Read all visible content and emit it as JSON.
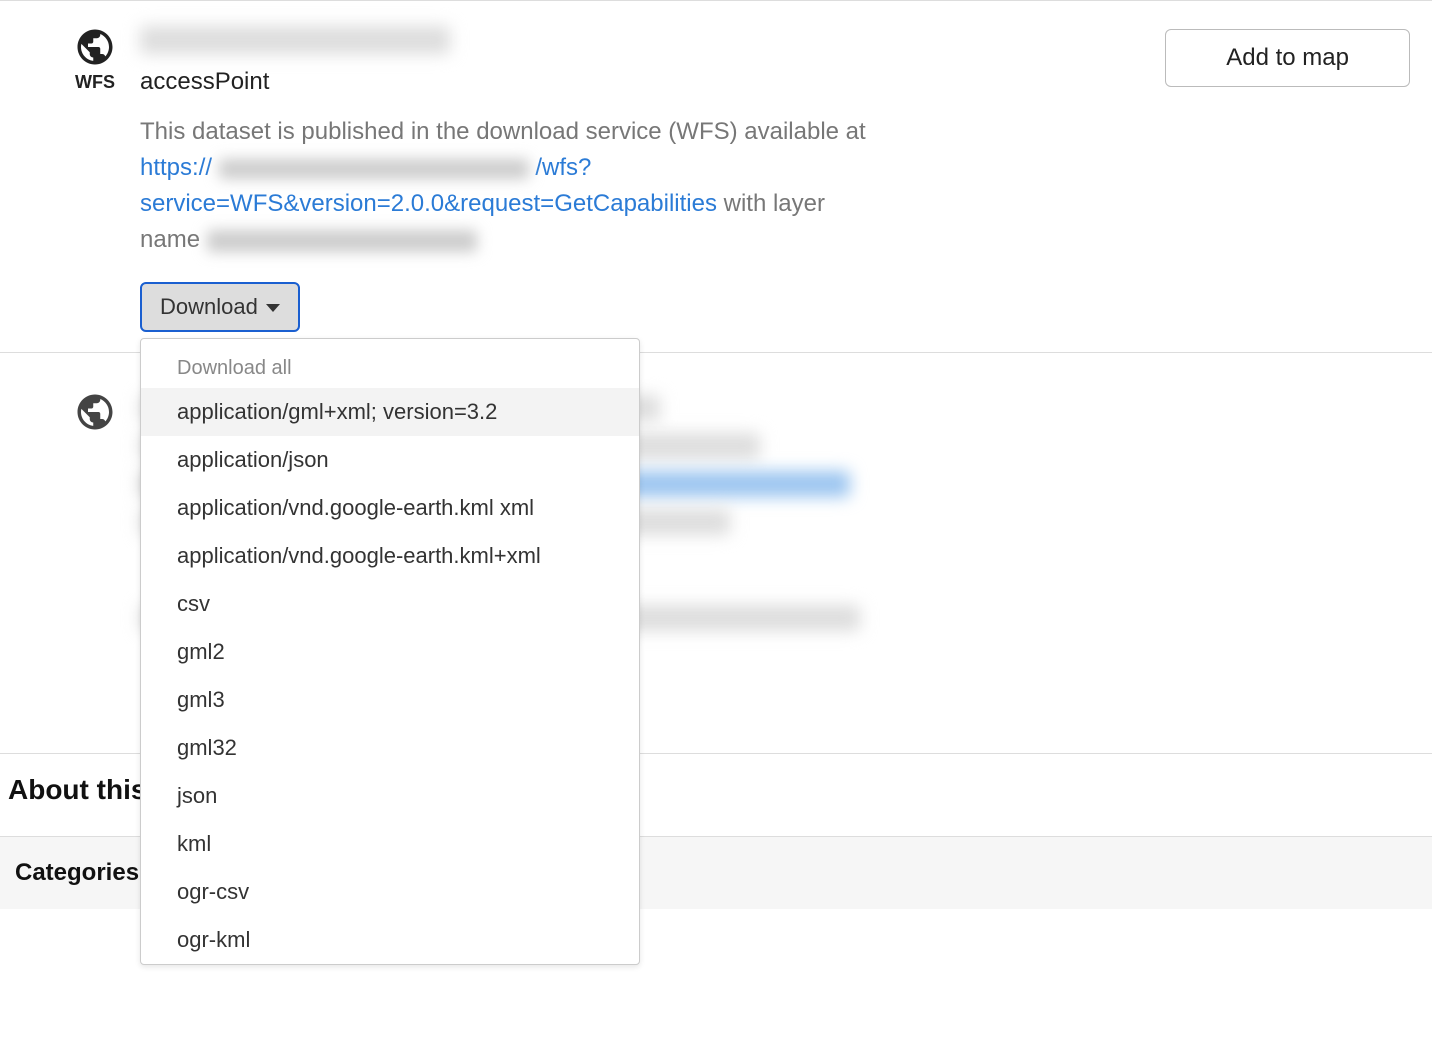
{
  "dataset": {
    "icon_label": "WFS",
    "access_point": "accessPoint",
    "description_prefix": "This dataset is published in the download service (WFS) available at ",
    "url_display": "https:// ________________ /wfs?service=WFS&version=2.0.0&request=GetCapabilities",
    "description_suffix1": " with layer name ",
    "add_to_map": "Add to map"
  },
  "download": {
    "button_label": "Download",
    "header": "Download all",
    "options": [
      "application/gml+xml; version=3.2",
      "application/json",
      "application/vnd.google-earth.kml xml",
      "application/vnd.google-earth.kml+xml",
      "csv",
      "gml2",
      "gml3",
      "gml32",
      "json",
      "kml",
      "ogr-csv",
      "ogr-kml"
    ]
  },
  "sections": {
    "about": "About this",
    "categories": "Categories"
  }
}
